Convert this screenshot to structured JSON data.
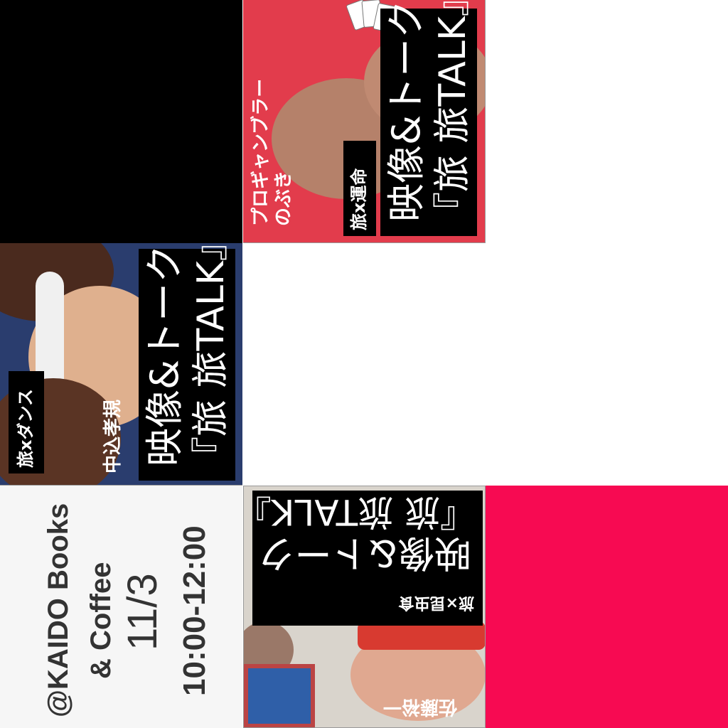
{
  "tiles": {
    "gambler": {
      "title_line1": "映像&トーク",
      "title_line2": "『旅 旅TALK』",
      "tag": "旅x運命",
      "speaker_line1": "プロギャンブラー",
      "speaker_line2": "のぶき"
    },
    "dance": {
      "title_line1": "映像&トーク",
      "title_line2": "『旅 旅TALK』",
      "tag": "旅xダンス",
      "speaker": "中込孝規"
    },
    "insect": {
      "title_line1": "映像&トーク",
      "title_line2": "『旅 旅TALK』",
      "tag": "旅×昆虫食",
      "speaker": "佐藤裕一"
    },
    "info": {
      "venue_line1": "@KAIDO Books",
      "venue_line2": "& Coffee",
      "date": "11/3",
      "time": "10:00-12:00"
    }
  },
  "colors": {
    "pink": "#f70a52",
    "gambler_bg": "#e23c4c",
    "black": "#000000",
    "info_bg": "#f6f6f6"
  }
}
